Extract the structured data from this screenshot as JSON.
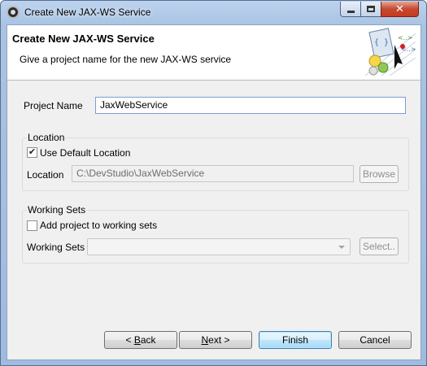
{
  "window": {
    "title": "Create New JAX-WS Service",
    "close_glyph": "✕"
  },
  "header": {
    "title": "Create New JAX-WS Service",
    "subtitle": "Give a project name for the new JAX-WS service",
    "graphic_icon": "web-service-wizard-icon"
  },
  "project": {
    "label": "Project Name",
    "value": "JaxWebService"
  },
  "location_group": {
    "title": "Location",
    "use_default_label": "Use Default Location",
    "use_default_checked": true,
    "location_label": "Location",
    "location_value": "C:\\DevStudio\\JaxWebService",
    "browse_label": "Browse"
  },
  "working_sets_group": {
    "title": "Working Sets",
    "add_label": "Add project to working sets",
    "add_checked": false,
    "working_sets_label": "Working Sets",
    "working_sets_value": "",
    "select_label": "Select.."
  },
  "buttons": {
    "back_prefix": "< ",
    "back_mnemonic": "B",
    "back_rest": "ack",
    "next_mnemonic": "N",
    "next_rest": "ext >",
    "finish": "Finish",
    "cancel": "Cancel"
  },
  "colors": {
    "titlebar": "#a9c3e3",
    "close_button": "#c9391e",
    "default_button_border": "#3c7fb1"
  }
}
